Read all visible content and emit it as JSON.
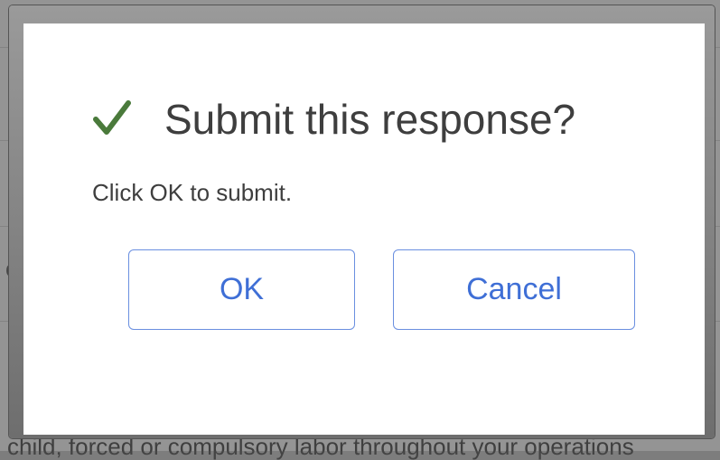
{
  "dialog": {
    "title": "Submit this response?",
    "message": "Click OK to submit.",
    "icon": "check-icon",
    "icon_color": "#4a7a3b",
    "ok_label": "OK",
    "cancel_label": "Cancel",
    "accent_color": "#3f6fd6"
  },
  "background": {
    "left_fragment": "o",
    "bottom_text": "child, forced or compulsory labor throughout your operations"
  }
}
